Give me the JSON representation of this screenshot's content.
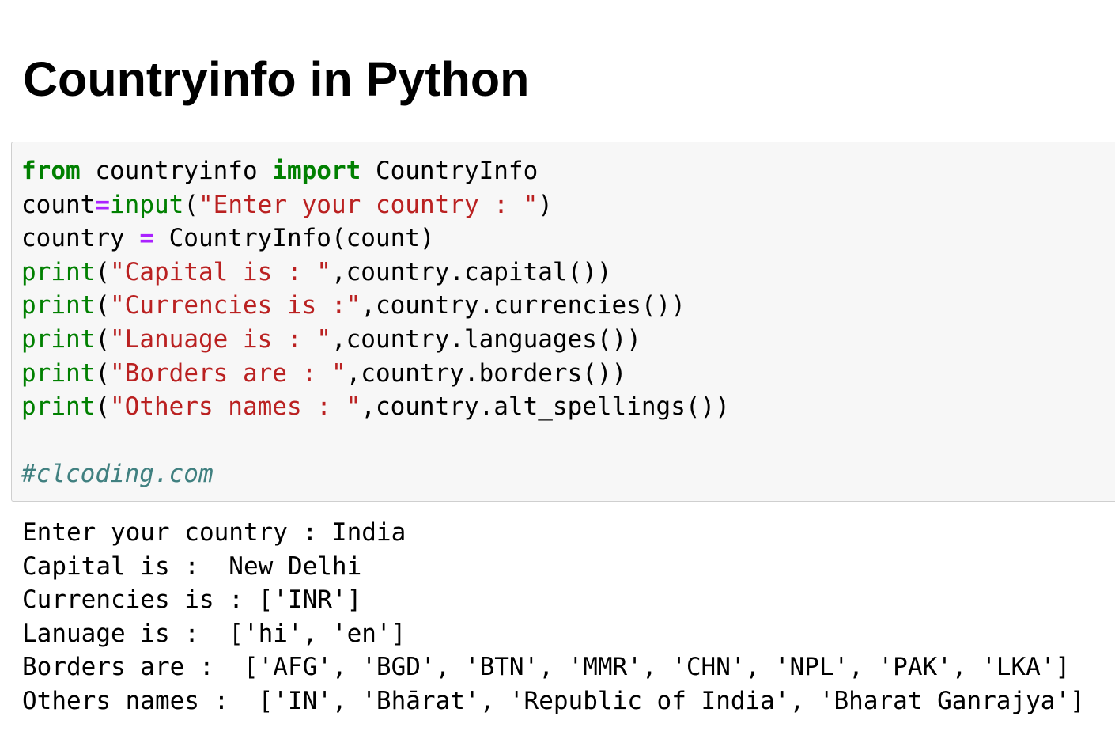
{
  "page": {
    "title": "Countryinfo in Python"
  },
  "code_cell": {
    "lines": [
      [
        {
          "t": "kw",
          "v": "from"
        },
        {
          "t": "tx",
          "v": " countryinfo "
        },
        {
          "t": "kw",
          "v": "import"
        },
        {
          "t": "tx",
          "v": " CountryInfo"
        }
      ],
      [
        {
          "t": "tx",
          "v": "count"
        },
        {
          "t": "op",
          "v": "="
        },
        {
          "t": "bi",
          "v": "input"
        },
        {
          "t": "tx",
          "v": "("
        },
        {
          "t": "str",
          "v": "\"Enter your country : \""
        },
        {
          "t": "tx",
          "v": ")"
        }
      ],
      [
        {
          "t": "tx",
          "v": "country "
        },
        {
          "t": "op",
          "v": "="
        },
        {
          "t": "tx",
          "v": " CountryInfo(count)"
        }
      ],
      [
        {
          "t": "bi",
          "v": "print"
        },
        {
          "t": "tx",
          "v": "("
        },
        {
          "t": "str",
          "v": "\"Capital is : \""
        },
        {
          "t": "tx",
          "v": ",country.capital())"
        }
      ],
      [
        {
          "t": "bi",
          "v": "print"
        },
        {
          "t": "tx",
          "v": "("
        },
        {
          "t": "str",
          "v": "\"Currencies is :\""
        },
        {
          "t": "tx",
          "v": ",country.currencies())"
        }
      ],
      [
        {
          "t": "bi",
          "v": "print"
        },
        {
          "t": "tx",
          "v": "("
        },
        {
          "t": "str",
          "v": "\"Lanuage is : \""
        },
        {
          "t": "tx",
          "v": ",country.languages())"
        }
      ],
      [
        {
          "t": "bi",
          "v": "print"
        },
        {
          "t": "tx",
          "v": "("
        },
        {
          "t": "str",
          "v": "\"Borders are : \""
        },
        {
          "t": "tx",
          "v": ",country.borders())"
        }
      ],
      [
        {
          "t": "bi",
          "v": "print"
        },
        {
          "t": "tx",
          "v": "("
        },
        {
          "t": "str",
          "v": "\"Others names : \""
        },
        {
          "t": "tx",
          "v": ",country.alt_spellings())"
        }
      ],
      [],
      [
        {
          "t": "cm",
          "v": "#clcoding.com"
        }
      ]
    ]
  },
  "output": {
    "lines": [
      "Enter your country : India",
      "Capital is :  New Delhi",
      "Currencies is : ['INR']",
      "Lanuage is :  ['hi', 'en']",
      "Borders are :  ['AFG', 'BGD', 'BTN', 'MMR', 'CHN', 'NPL', 'PAK', 'LKA']",
      "Others names :  ['IN', 'Bhārat', 'Republic of India', 'Bharat Ganrajya']"
    ]
  },
  "colors": {
    "keyword": "#008000",
    "builtin": "#008000",
    "string": "#ba2121",
    "operator": "#aa22ff",
    "comment": "#408080",
    "cell_background": "#f7f7f7",
    "cell_border": "#cfcfcf"
  }
}
